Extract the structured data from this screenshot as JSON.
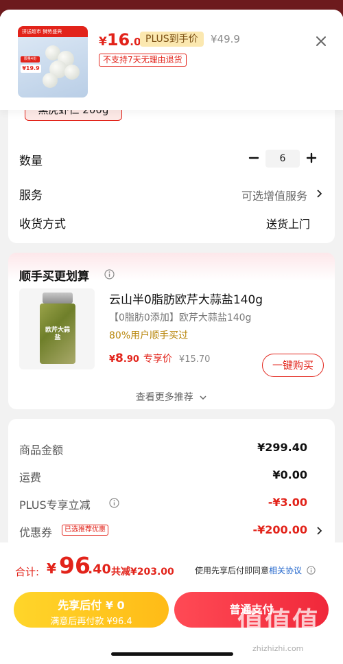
{
  "header": {
    "thumb": {
      "band_text": "拼送超市 狮势盛典",
      "tag1": "限量4份",
      "price_tag": "¥19.9"
    },
    "price": {
      "currency": "¥",
      "integer": "16",
      "decimal": ".06"
    },
    "plus_badge": "PLUS到手价",
    "original_price": "¥49.9",
    "no_return_tag": "不支持7天无理由退货"
  },
  "spec": {
    "selected_chip": "黑虎虾仁 200g",
    "quantity_label": "数量",
    "quantity_value": "6",
    "service_label": "服务",
    "service_value": "可选增值服务",
    "delivery_label": "收货方式",
    "delivery_value": "送货上门"
  },
  "recommend": {
    "title": "顺手买更划算",
    "product_name": "云山半0脂肪欧芹大蒜盐140g",
    "product_desc": "【0脂肪0添加】欧芹大蒜盐140g",
    "product_note": "80%用户顺手买过",
    "jar_label": "欧芹大蒜盐",
    "price": {
      "currency": "¥",
      "integer": "8",
      "decimal": ".90"
    },
    "price_label": "专享价",
    "original_price": "¥15.70",
    "buy_button": "一键购买",
    "more_label": "查看更多推荐"
  },
  "summary": {
    "rows": [
      {
        "label": "商品金额",
        "value": "¥299.40",
        "red": false
      },
      {
        "label": "运费",
        "value": "¥0.00",
        "red": false
      },
      {
        "label": "PLUS专享立减",
        "value": "-¥3.00",
        "red": true
      },
      {
        "label": "优惠券",
        "value": "-¥200.00",
        "red": true
      }
    ],
    "coupon_tag": "已选推荐优惠"
  },
  "footer": {
    "total_label": "合计:",
    "total_currency": "¥",
    "total_integer": "96",
    "total_decimal": ".40",
    "total_saving": "共减¥203.00",
    "agree_text": "使用先享后付即同意",
    "agree_link": "相关协议",
    "pay_later": {
      "line1": "先享后付 ¥ 0",
      "line2": "满意后再付款 ¥96.4"
    },
    "normal_pay": "普通支付",
    "watermark_logo": "值值值",
    "watermark": "zhizhizhi.com"
  },
  "colors": {
    "accent": "#e2231a",
    "plus_bg": "#fbe8b0",
    "pay_later": "#ffc520",
    "normal_pay": "#f0283a"
  }
}
